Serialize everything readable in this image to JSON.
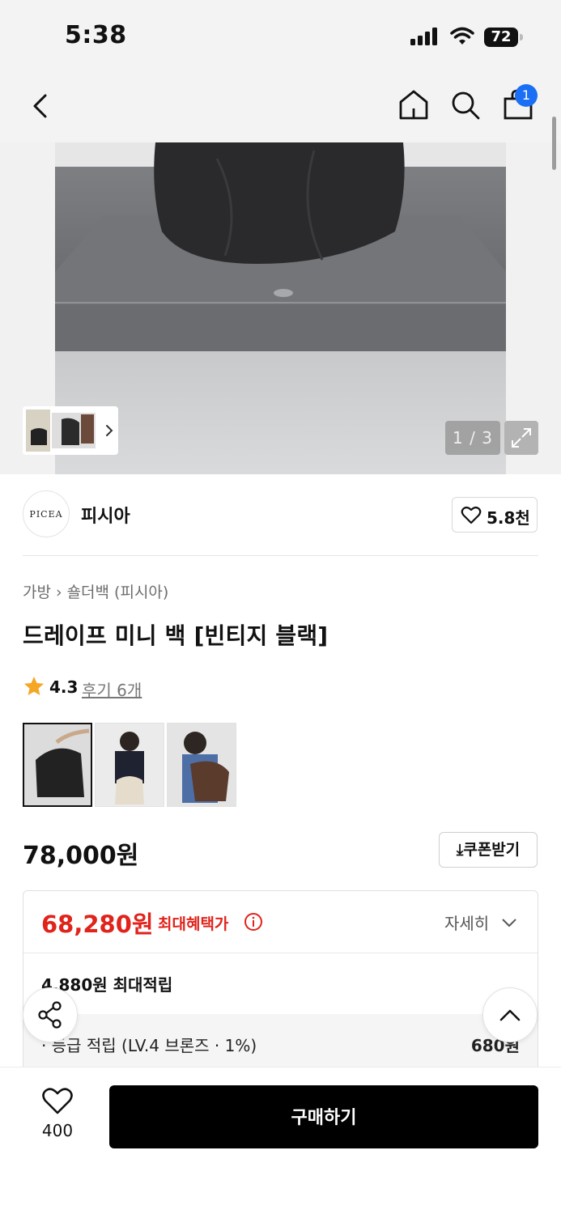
{
  "status_bar": {
    "time": "5:38",
    "battery": "72"
  },
  "nav": {
    "cart_count": "1"
  },
  "gallery": {
    "pager": "1 / 3"
  },
  "brand": {
    "logo_text": "PICEA",
    "name": "피시아",
    "likes": "5.8천"
  },
  "breadcrumb": {
    "category": "가방",
    "subcategory": "숄더백 (피시아)"
  },
  "product": {
    "title": "드레이프 미니 백 [빈티지 블랙]",
    "rating": "4.3",
    "reviews": "후기 6개",
    "price": "78,000원",
    "coupon_label": "쿠폰받기"
  },
  "benefit": {
    "best_price": "68,280원",
    "best_label": "최대혜택가",
    "detail_label": "자세히",
    "points": "4,880원 최대적립",
    "tier_label": "· 등급 적립 (LV.4 브론즈 · 1%)",
    "tier_value": "680원"
  },
  "bottom_bar": {
    "wish_count": "400",
    "buy_label": "구매하기"
  },
  "colors": {
    "accent_red": "#e0231b",
    "badge_blue": "#1a6ff5",
    "buy_black": "#000000"
  }
}
